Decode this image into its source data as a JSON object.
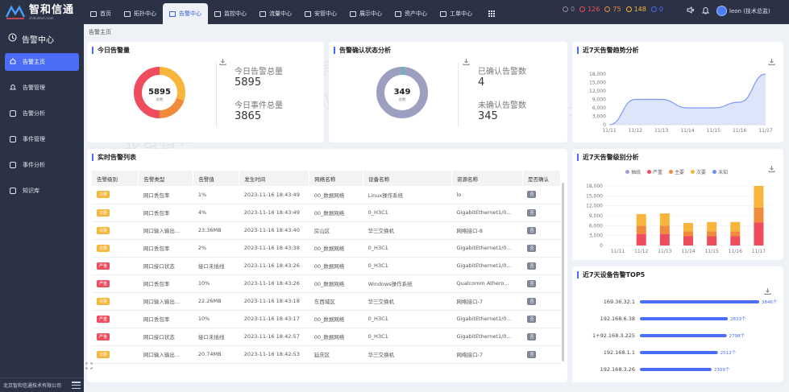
{
  "app": {
    "name": "智和信通",
    "sub": "zhihuitech.com",
    "copyright": "北京智和信通技术有限公司",
    "watermark": "北京智和信通技术有限公司"
  },
  "nav": [
    {
      "label": "首页",
      "icon": "home-icon"
    },
    {
      "label": "拓扑中心",
      "icon": "topology-icon"
    },
    {
      "label": "告警中心",
      "icon": "alarm-icon",
      "active": true
    },
    {
      "label": "监控中心",
      "icon": "monitor-icon"
    },
    {
      "label": "流量中心",
      "icon": "traffic-icon"
    },
    {
      "label": "安管中心",
      "icon": "security-icon"
    },
    {
      "label": "展示中心",
      "icon": "display-icon"
    },
    {
      "label": "资产中心",
      "icon": "asset-icon"
    },
    {
      "label": "工单中心",
      "icon": "ticket-icon"
    }
  ],
  "alert_counts": [
    {
      "value": "0",
      "color": "#8a8f9c"
    },
    {
      "value": "126",
      "color": "#ef4c5d"
    },
    {
      "value": "75",
      "color": "#f08a3c"
    },
    {
      "value": "148",
      "color": "#f7b53b"
    },
    {
      "value": "0",
      "color": "#4a6cf7"
    }
  ],
  "user": {
    "name": "leon (技术总监)"
  },
  "sidebar": {
    "title": "告警中心",
    "items": [
      {
        "label": "告警主页",
        "active": true
      },
      {
        "label": "告警管理"
      },
      {
        "label": "告警分析"
      },
      {
        "label": "事件管理"
      },
      {
        "label": "事件分析"
      },
      {
        "label": "知识库"
      }
    ]
  },
  "breadcrumb": "告警主页",
  "today": {
    "title": "今日告警量",
    "center_value": "5895",
    "center_label": "总数",
    "alarm_total_label": "今日告警总量",
    "alarm_total": "5895",
    "event_total_label": "今日事件总量",
    "event_total": "3865",
    "segments": [
      {
        "value": 0.3,
        "color": "#f7b53b"
      },
      {
        "value": 0.2,
        "color": "#f08a3c"
      },
      {
        "value": 0.5,
        "color": "#ef4c5d"
      }
    ]
  },
  "confirm": {
    "title": "告警确认状态分析",
    "center_value": "349",
    "center_label": "总数",
    "confirmed_label": "已确认告警数",
    "confirmed": "4",
    "unconfirmed_label": "未确认告警数",
    "unconfirmed": "345"
  },
  "table": {
    "title": "实时告警列表",
    "headers": [
      "告警级别",
      "告警类型",
      "告警值",
      "发生时间",
      "网络名称",
      "设备名称",
      "资源名称",
      "是否确认"
    ],
    "rows": [
      {
        "level": "次要",
        "sev": "minor",
        "type": "网口丢包率",
        "value": "1%",
        "time": "2023-11-16 18:43:49",
        "net": "00_数据网络",
        "device": "Linux操作系统",
        "res": "lo",
        "confirm": "否"
      },
      {
        "level": "次要",
        "sev": "minor",
        "type": "网口丢包率",
        "value": "4%",
        "time": "2023-11-16 18:43:49",
        "net": "00_数据网络",
        "device": "0_H3C1",
        "res": "GigabitEthernet1/0...",
        "confirm": "否"
      },
      {
        "level": "次要",
        "sev": "minor",
        "type": "网口输入输出...",
        "value": "23.36MB",
        "time": "2023-11-16 18:43:40",
        "net": "房山区",
        "device": "华三交换机",
        "res": "网络接口-8",
        "confirm": "否"
      },
      {
        "level": "次要",
        "sev": "minor",
        "type": "网口丢包率",
        "value": "2%",
        "time": "2023-11-16 18:43:38",
        "net": "00_数据网络",
        "device": "0_H3C1",
        "res": "GigabitEthernet1/0...",
        "confirm": "否"
      },
      {
        "level": "严重",
        "sev": "major",
        "type": "网口接口状态",
        "value": "接口未插线",
        "time": "2023-11-16 18:43:26",
        "net": "00_数据网络",
        "device": "0_H3C1",
        "res": "GigabitEthernet1/0...",
        "confirm": "否"
      },
      {
        "level": "严重",
        "sev": "major",
        "type": "网口丢包率",
        "value": "10%",
        "time": "2023-11-16 18:43:26",
        "net": "00_数据网络",
        "device": "Windows操作系统",
        "res": "Qualcomm Athero...",
        "confirm": "否"
      },
      {
        "level": "次要",
        "sev": "minor",
        "type": "网口输入输出...",
        "value": "22.26MB",
        "time": "2023-11-16 18:43:18",
        "net": "东西城区",
        "device": "华三交换机",
        "res": "网络接口-7",
        "confirm": "否"
      },
      {
        "level": "严重",
        "sev": "major",
        "type": "网口丢包率",
        "value": "10%",
        "time": "2023-11-16 18:43:17",
        "net": "00_数据网络",
        "device": "0_H3C1",
        "res": "GigabitEthernet1/0...",
        "confirm": "否"
      },
      {
        "level": "严重",
        "sev": "major",
        "type": "网口接口状态",
        "value": "接口未插线",
        "time": "2023-11-16 18:42:57",
        "net": "00_数据网络",
        "device": "0_H3C1",
        "res": "GigabitEthernet1/0...",
        "confirm": "否"
      },
      {
        "level": "次要",
        "sev": "minor",
        "type": "网口输入输出...",
        "value": "20.74MB",
        "time": "2023-11-16 18:42:53",
        "net": "延庆区",
        "device": "华三交换机",
        "res": "网络接口-7",
        "confirm": "否"
      }
    ]
  },
  "trend": {
    "title": "近7天告警趋势分析",
    "x": [
      "11/11",
      "11/12",
      "11/13",
      "11/14",
      "11/15",
      "11/16",
      "11/17"
    ],
    "y_ticks": [
      "18,000",
      "15,000",
      "12,000",
      "9,000",
      "6,000",
      "3,000",
      "0"
    ]
  },
  "level": {
    "title": "近7天告警级别分析",
    "legend": [
      {
        "label": "抽线",
        "color": "#9c9fd6"
      },
      {
        "label": "严重",
        "color": "#ef4c5d"
      },
      {
        "label": "主要",
        "color": "#f08a3c"
      },
      {
        "label": "次要",
        "color": "#f7b53b"
      },
      {
        "label": "未知",
        "color": "#6b8cf0"
      }
    ],
    "x": [
      "11/11",
      "11/12",
      "11/13",
      "11/14",
      "11/15",
      "11/16",
      "11/17"
    ],
    "y_ticks": [
      "18,000",
      "15,000",
      "12,000",
      "9,000",
      "6,000",
      "3,000",
      "0"
    ]
  },
  "top5": {
    "title": "近7天设备告警TOP5",
    "labels": [
      "169.36.32.1",
      "192.168.6.38",
      "1+92.168.3.225",
      "192.168.1.1",
      "192.168.3.26"
    ],
    "value_labels": [
      "3846个",
      "2833个",
      "2798个",
      "2512个",
      "2309个"
    ]
  },
  "chart_data": [
    {
      "type": "line",
      "title": "近7天告警趋势分析",
      "x": [
        "11/11",
        "11/12",
        "11/13",
        "11/14",
        "11/15",
        "11/16",
        "11/17"
      ],
      "values": [
        0,
        9000,
        9000,
        6000,
        6000,
        8000,
        18000
      ],
      "ylim": [
        0,
        18000
      ]
    },
    {
      "type": "bar",
      "title": "近7天告警级别分析",
      "categories": [
        "11/11",
        "11/12",
        "11/13",
        "11/14",
        "11/15",
        "11/16",
        "11/17"
      ],
      "ylim": [
        0,
        18000
      ],
      "series": [
        {
          "name": "严重",
          "color": "#ef4c5d",
          "values": [
            0,
            3500,
            3500,
            2800,
            2800,
            2800,
            7000
          ]
        },
        {
          "name": "主要",
          "color": "#f08a3c",
          "values": [
            0,
            2500,
            2500,
            1500,
            1500,
            1500,
            4500
          ]
        },
        {
          "name": "次要",
          "color": "#f7b53b",
          "values": [
            0,
            3500,
            3700,
            2500,
            2800,
            2800,
            6500
          ]
        }
      ]
    },
    {
      "type": "bar",
      "title": "近7天设备告警TOP5",
      "categories": [
        "169.36.32.1",
        "192.168.6.38",
        "1+92.168.3.225",
        "192.168.1.1",
        "192.168.3.26"
      ],
      "values": [
        3846,
        2833,
        2798,
        2512,
        2309
      ]
    }
  ]
}
